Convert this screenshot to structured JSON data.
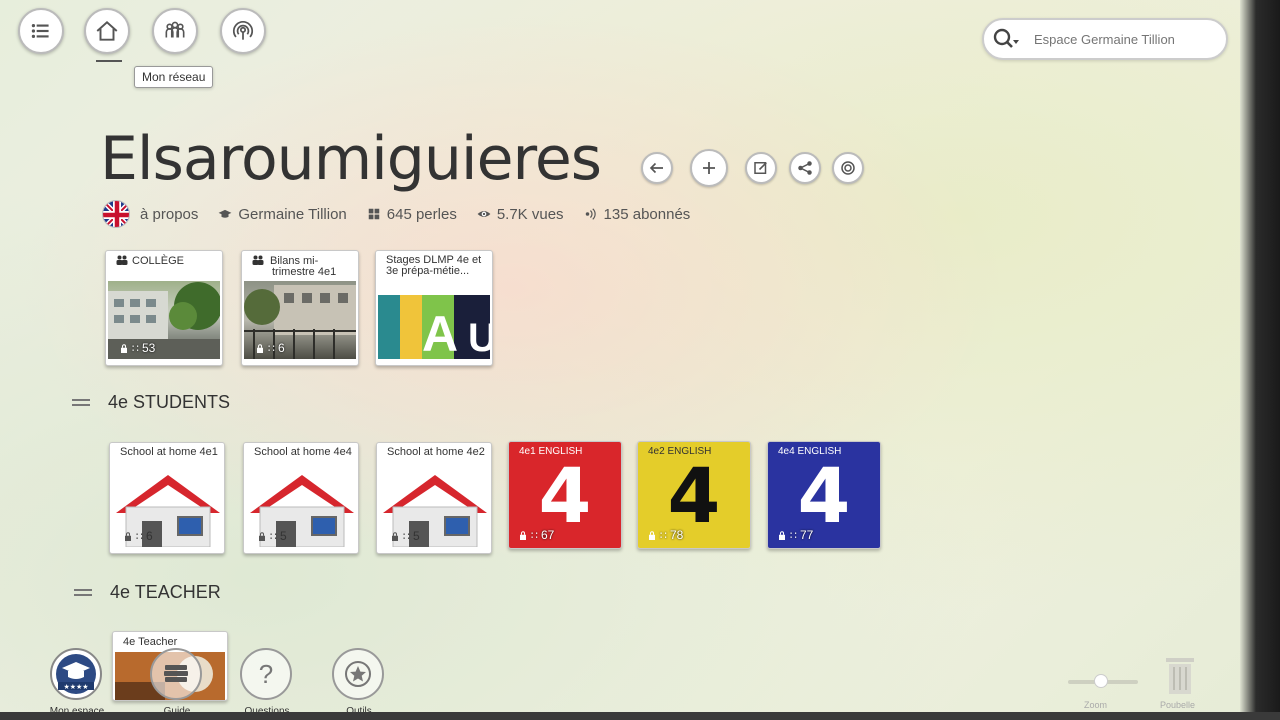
{
  "nav": {
    "menu_icon": "list-icon",
    "home_icon": "home-icon",
    "network_icon": "people-icon",
    "broadcast_icon": "broadcast-icon",
    "tooltip": "Mon réseau"
  },
  "search": {
    "placeholder": "Espace Germaine Tillion"
  },
  "space": {
    "title": "Elsaroumiguieres",
    "about": "à propos",
    "school": "Germaine Tillion",
    "pearls": "645 perles",
    "views": "5.7K vues",
    "subscribers": "135 abonnés"
  },
  "top_cards": [
    {
      "title": "COLLÈGE",
      "count": "53",
      "icon": "group-icon"
    },
    {
      "title": "Bilans mi-trimestre 4e1",
      "count": "6",
      "icon": "group-icon"
    },
    {
      "title": "Stages DLMP 4e et 3e prépa-métie...",
      "count": ""
    }
  ],
  "sections": [
    {
      "label": "4e STUDENTS"
    },
    {
      "label": "4e TEACHER"
    }
  ],
  "student_cards": [
    {
      "title": "School at home 4e1",
      "count": "6"
    },
    {
      "title": "School at home 4e4",
      "count": "5"
    },
    {
      "title": "School at home 4e2",
      "count": "5"
    },
    {
      "title": "4e1 ENGLISH",
      "count": "67",
      "color": "#d9262b",
      "digit": "4",
      "digit_color": "#ffffff"
    },
    {
      "title": "4e2 ENGLISH",
      "count": "78",
      "color": "#e4cd2a",
      "digit": "4",
      "digit_color": "#111111"
    },
    {
      "title": "4e4 ENGLISH",
      "count": "77",
      "color": "#2a33a0",
      "digit": "4",
      "digit_color": "#ffffff"
    }
  ],
  "teacher_cards": [
    {
      "title": "4e Teacher"
    }
  ],
  "bottom_tools": [
    {
      "label": "Mon espace"
    },
    {
      "label": "Guide"
    },
    {
      "label": "Questions"
    },
    {
      "label": "Outils"
    }
  ],
  "bottom_right": {
    "zoom_label": "Zoom",
    "trash_label": "Poubelle"
  }
}
